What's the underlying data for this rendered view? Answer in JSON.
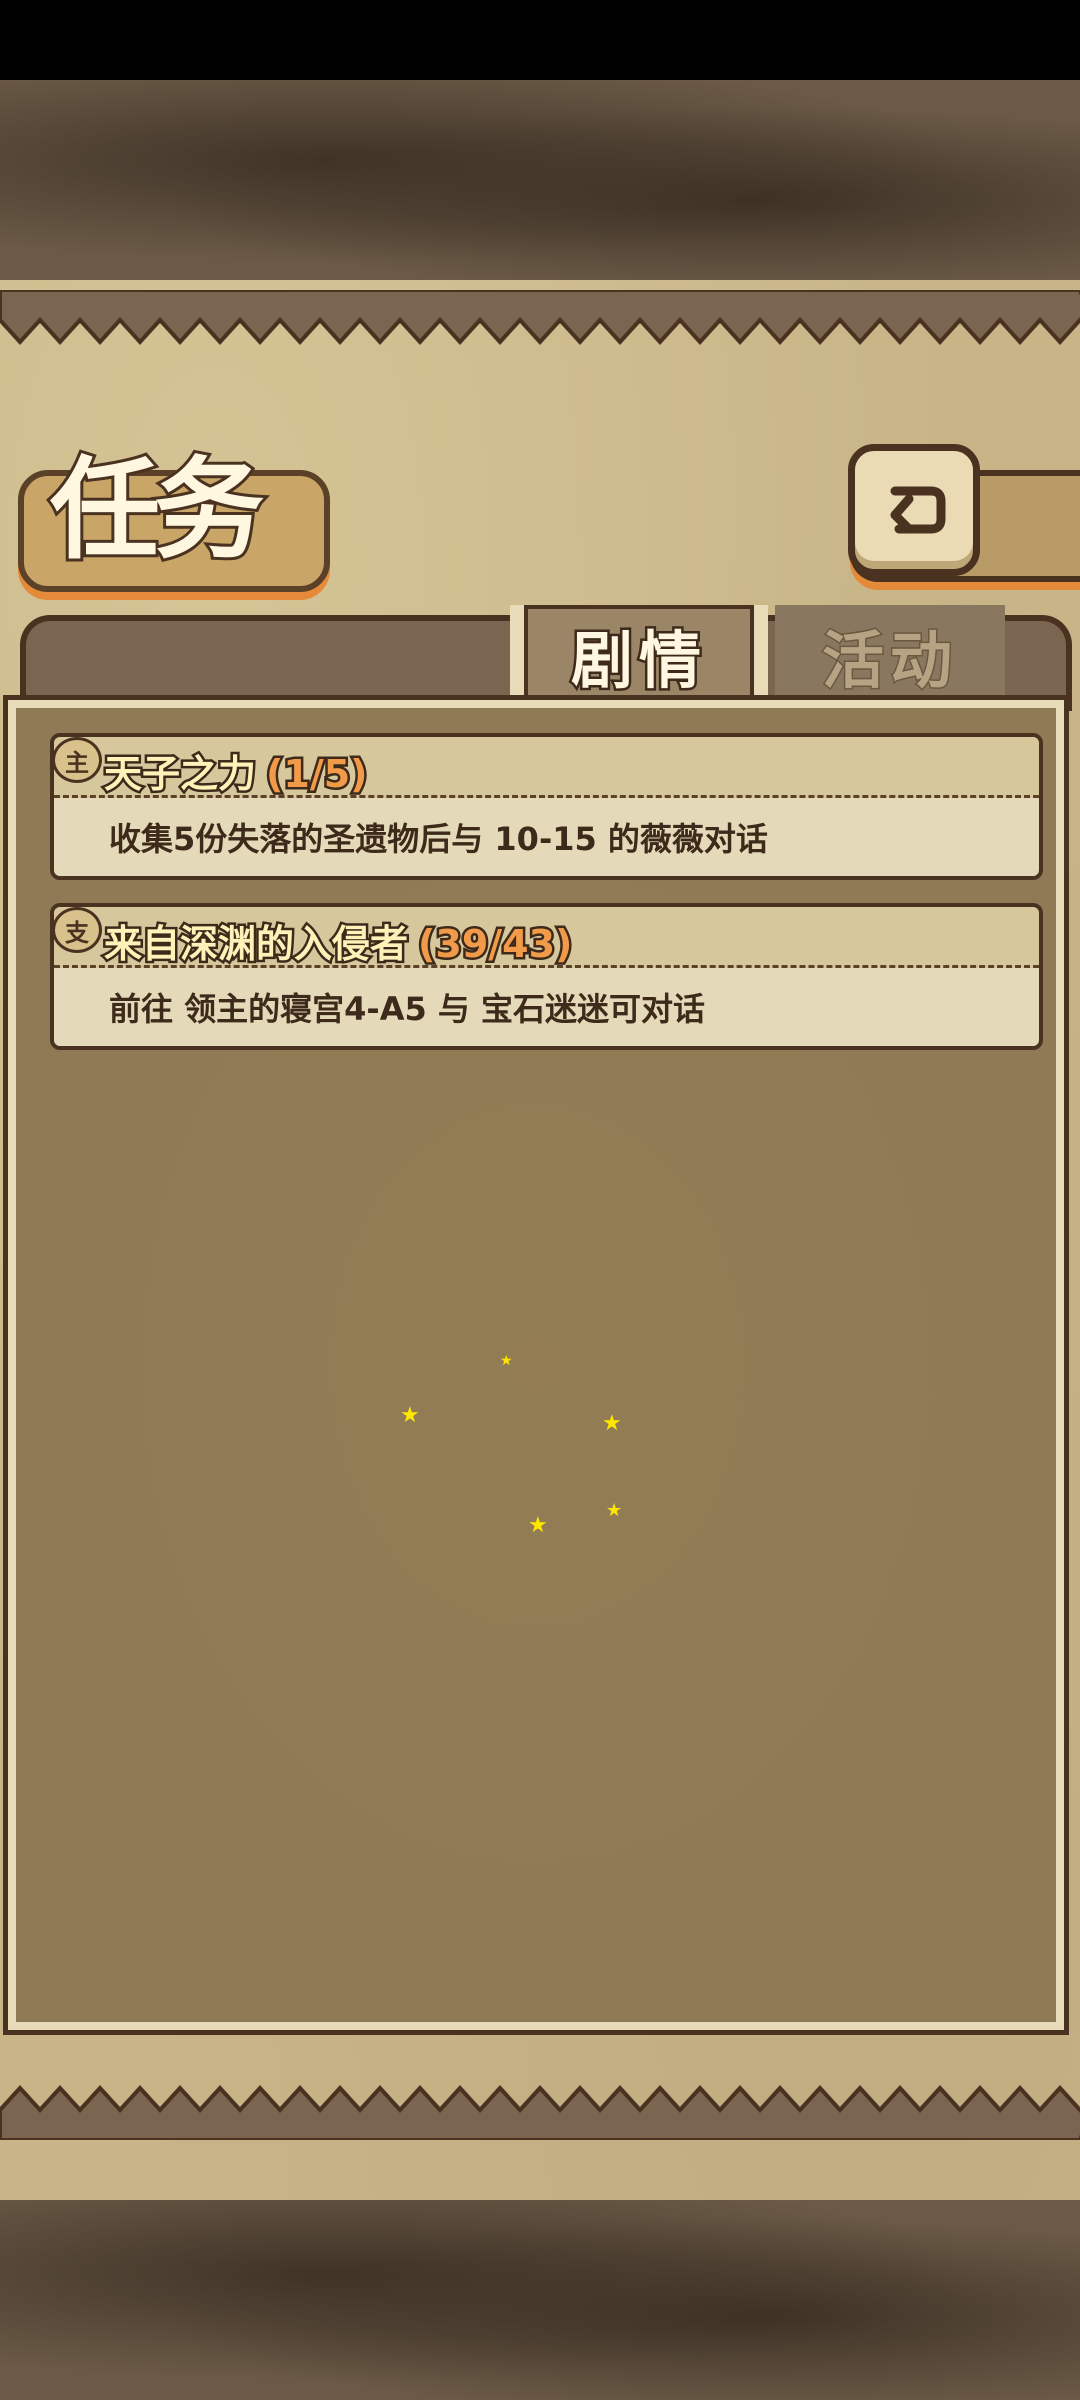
{
  "page": {
    "title": "任务"
  },
  "tabs": [
    {
      "label": "剧情",
      "active": true
    },
    {
      "label": "活动",
      "active": false
    }
  ],
  "quests": [
    {
      "icon": "主",
      "name": "天子之力",
      "progress": "(1/5)",
      "description": "收集5份失落的圣遗物后与 10-15 的薇薇对话"
    },
    {
      "icon": "支",
      "name": "来自深渊的入侵者",
      "progress": "(39/43)",
      "description": "前往 领主的寝宫4-A5 与 宝石迷迷可对话"
    }
  ],
  "colors": {
    "parchment": "#c7b588",
    "panel": "#8e7a55",
    "outline": "#4a3220",
    "accent_orange": "#e48a39",
    "progress_text": "#f09a4a"
  },
  "icons": {
    "back": "return-arrow-icon",
    "sparkle": "star-sparkle-icon"
  }
}
